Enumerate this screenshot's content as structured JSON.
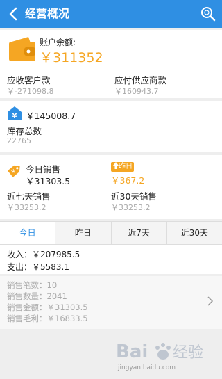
{
  "header": {
    "title": "经营概况",
    "back_icon": "chevron-left-icon",
    "search_icon": "search-icon"
  },
  "account": {
    "balance_label": "账户余额:",
    "balance_value": "￥311352",
    "receivable_label": "应收客户款",
    "receivable_value": "￥-271098.8",
    "payable_label": "应付供应商款",
    "payable_value": "￥160943.7"
  },
  "inventory": {
    "amount": "￥145008.7",
    "label": "库存总数",
    "count": "22765"
  },
  "sales": {
    "today_label": "今日销售",
    "today_value": "￥31303.5",
    "yesterday_badge": "昨日",
    "yesterday_value": "￥367.2",
    "week_label": "近七天销售",
    "week_value": "￥33253.2",
    "month_label": "近30天销售",
    "month_value": "￥33253.2"
  },
  "tabs": [
    {
      "label": "今日"
    },
    {
      "label": "昨日"
    },
    {
      "label": "近7天"
    },
    {
      "label": "近30天"
    }
  ],
  "summary": {
    "income": "收入：￥207985.5",
    "expense": "支出：￥5583.1"
  },
  "stats": {
    "count": "销售笔数：10",
    "quantity": "销售数量：2041",
    "amount": "销售金额：￥31303.5",
    "profit": "销售毛利：￥16833.5"
  },
  "watermark": {
    "text": "jingyan.baidu.com"
  },
  "colors": {
    "header_blue": "#2f8fe3",
    "accent_orange": "#f5a623"
  }
}
